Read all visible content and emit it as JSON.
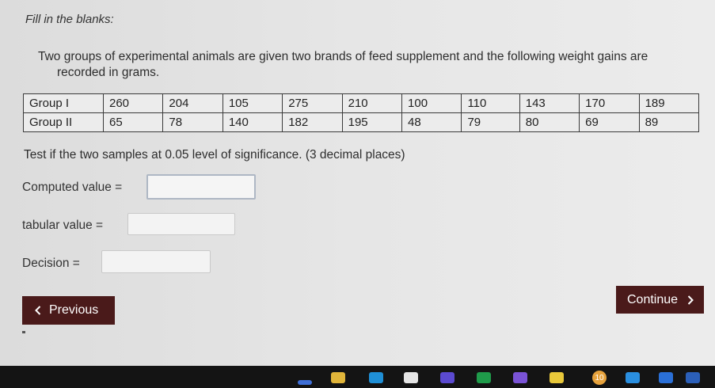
{
  "instructions": "Fill in the blanks:",
  "problem": {
    "line1": "Two groups of experimental animals are given two brands of feed supplement and the following weight gains are",
    "line2": "recorded in grams."
  },
  "table": {
    "rows": [
      {
        "label": "Group I",
        "values": [
          "260",
          "204",
          "105",
          "275",
          "210",
          "100",
          "110",
          "143",
          "170",
          "189"
        ]
      },
      {
        "label": "Group II",
        "values": [
          "65",
          "78",
          "140",
          "182",
          "195",
          "48",
          "79",
          "80",
          "69",
          "89"
        ]
      }
    ]
  },
  "question": "Test if the two samples at 0.05 level of significance. (3 decimal places)",
  "fields": {
    "computed_label": "Computed value =",
    "computed_value": "",
    "tabular_label": "tabular value =",
    "tabular_value": "",
    "decision_label": "Decision =",
    "decision_value": ""
  },
  "nav": {
    "previous": "Previous",
    "continue": "Continue"
  },
  "taskbar": {
    "badge": "10"
  },
  "colors": {
    "button_bg": "#4a1a1a",
    "taskbar_bg": "#141414"
  }
}
